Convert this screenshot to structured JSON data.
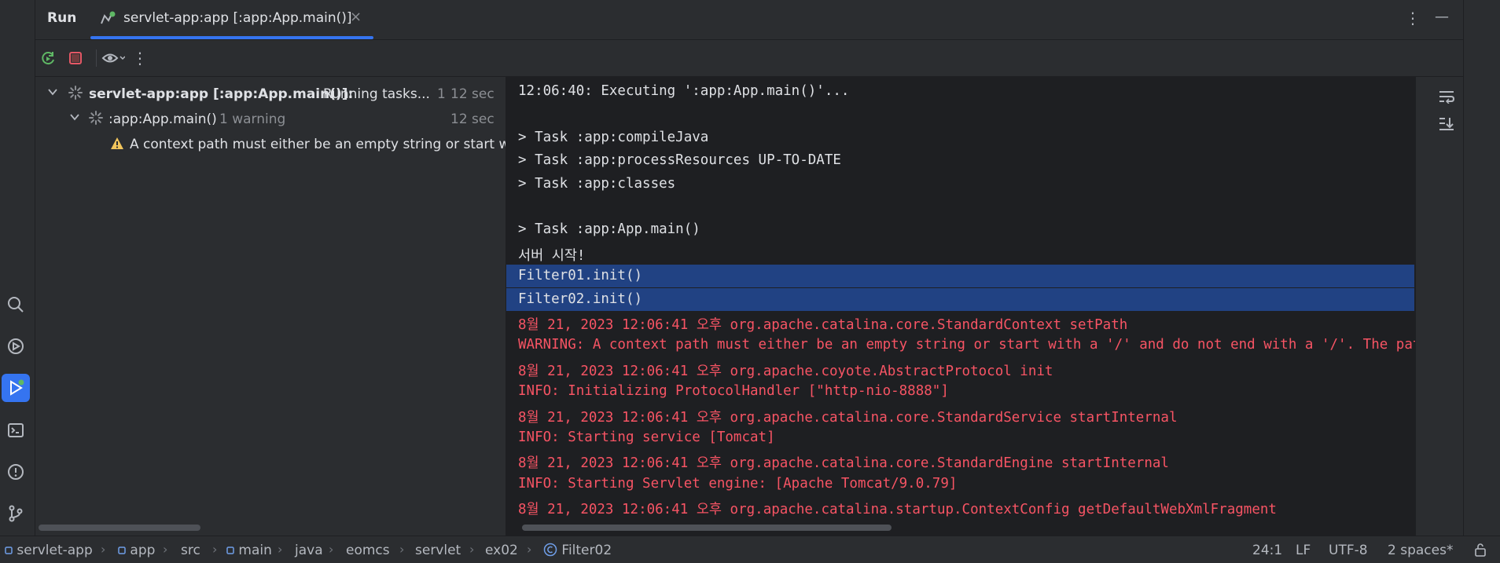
{
  "header": {
    "run_label": "Run",
    "tab_title": "servlet-app:app [:app:App.main()]",
    "tab_close": "×",
    "more_menu": "⋮",
    "minimize": "—"
  },
  "tree": {
    "root": {
      "title": "servlet-app:app [:app:App.main()]:",
      "status": "Running tasks...",
      "count": "1",
      "time": "12 sec"
    },
    "child": {
      "title": ":app:App.main()",
      "warning_count": "1 warning",
      "time": "12 sec"
    },
    "warning": {
      "text": "A context path must either be an empty string or start with"
    }
  },
  "console": {
    "lines": [
      {
        "text": "12:06:40: Executing ':app:App.main()'...",
        "kind": "normal"
      },
      {
        "text": "",
        "kind": "normal"
      },
      {
        "text": "> Task :app:compileJava",
        "kind": "normal"
      },
      {
        "text": "> Task :app:processResources UP-TO-DATE",
        "kind": "normal"
      },
      {
        "text": "> Task :app:classes",
        "kind": "normal"
      },
      {
        "text": "",
        "kind": "normal"
      },
      {
        "text": "> Task :app:App.main()",
        "kind": "normal"
      },
      {
        "text": "서버 시작!",
        "kind": "normal"
      },
      {
        "text": "Filter01.init()",
        "kind": "normal"
      },
      {
        "text": "Filter02.init()",
        "kind": "normal"
      },
      {
        "text": "8월 21, 2023 12:06:41 오후 org.apache.catalina.core.StandardContext setPath",
        "kind": "err"
      },
      {
        "text": "WARNING: A context path must either be an empty string or start with a '/' and do not end with a '/'. The path [/]",
        "kind": "err"
      },
      {
        "text": "8월 21, 2023 12:06:41 오후 org.apache.coyote.AbstractProtocol init",
        "kind": "err"
      },
      {
        "text": "INFO: Initializing ProtocolHandler [\"http-nio-8888\"]",
        "kind": "err"
      },
      {
        "text": "8월 21, 2023 12:06:41 오후 org.apache.catalina.core.StandardService startInternal",
        "kind": "err"
      },
      {
        "text": "INFO: Starting service [Tomcat]",
        "kind": "err"
      },
      {
        "text": "8월 21, 2023 12:06:41 오후 org.apache.catalina.core.StandardEngine startInternal",
        "kind": "err"
      },
      {
        "text": "INFO: Starting Servlet engine: [Apache Tomcat/9.0.79]",
        "kind": "err"
      },
      {
        "text": "8월 21, 2023 12:06:41 오후 org.apache.catalina.startup.ContextConfig getDefaultWebXmlFragment",
        "kind": "err"
      }
    ],
    "selected_rows": [
      8,
      9
    ]
  },
  "status_bar": {
    "breadcrumbs": [
      "servlet-app",
      "app",
      "src",
      "main",
      "java",
      "eomcs",
      "servlet",
      "ex02",
      "Filter02"
    ],
    "position": "24:1",
    "line_sep": "LF",
    "encoding": "UTF-8",
    "indent": "2 spaces*"
  },
  "colors": {
    "accent": "#3574f0",
    "error_text": "#f75464",
    "selection": "#214283",
    "warning": "#f2c55c",
    "run_green": "#5fb865",
    "stop_red": "#e55765"
  }
}
